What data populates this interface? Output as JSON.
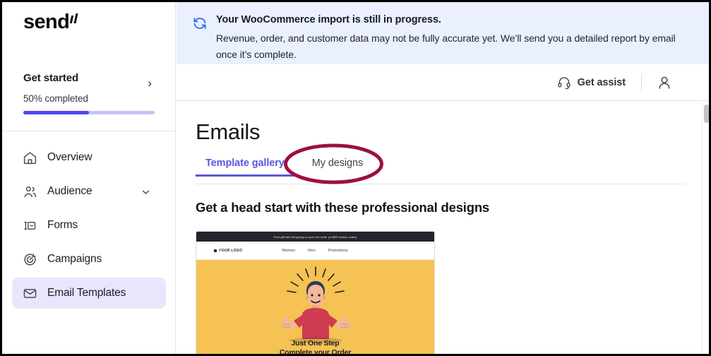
{
  "brand": {
    "name": "send",
    "accent": "#5757dd",
    "progress_fill": "#4a47f0",
    "annotation_color": "#9d1040"
  },
  "sidebar": {
    "get_started": {
      "title": "Get started",
      "progress_label": "50% completed",
      "progress_percent": 50,
      "chevron": "›"
    },
    "items": [
      {
        "label": "Overview",
        "icon": "home-icon",
        "active": false,
        "expandable": false
      },
      {
        "label": "Audience",
        "icon": "users-icon",
        "active": false,
        "expandable": true
      },
      {
        "label": "Forms",
        "icon": "form-icon",
        "active": false,
        "expandable": false
      },
      {
        "label": "Campaigns",
        "icon": "target-icon",
        "active": false,
        "expandable": false
      },
      {
        "label": "Email Templates",
        "icon": "envelope-icon",
        "active": true,
        "expandable": false
      }
    ]
  },
  "banner": {
    "icon": "sync-refresh-icon",
    "title": "Your WooCommerce import is still in progress.",
    "body": "Revenue, order, and customer data may not be fully accurate yet. We’ll send you a detailed report by email once it’s complete.",
    "background": "#eaf0fd"
  },
  "topbar": {
    "assist_label": "Get assist",
    "assist_icon": "headset-icon",
    "avatar_icon": "user-avatar-icon"
  },
  "main": {
    "page_title": "Emails",
    "tabs": [
      {
        "label": "Template gallery",
        "active": true
      },
      {
        "label": "My designs",
        "active": false
      }
    ],
    "section_heading": "Get a head start with these professional designs"
  },
  "template_card": {
    "top_banner_text": "Free gift with shopping on your 3rd order (of $50 dollars, order)",
    "logo_text": "YOUR LOGO",
    "nav_links": [
      "Women",
      "Men",
      "Promotions"
    ],
    "caption_line1": "Just One Step",
    "caption_line2": "Complete your Order",
    "hero_background": "#f5c253"
  },
  "scrollbar": {
    "position": "top"
  }
}
